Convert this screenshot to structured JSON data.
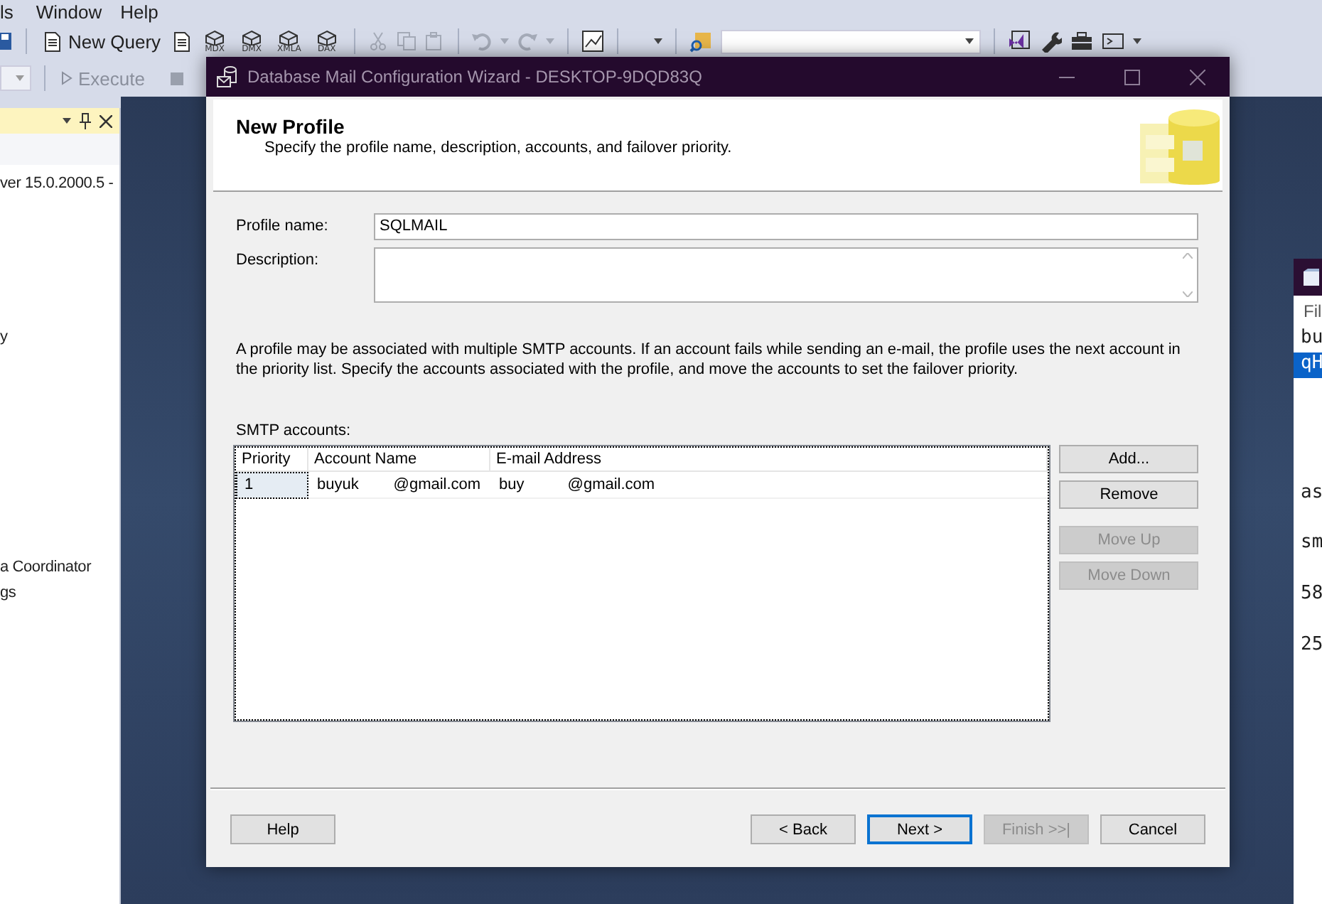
{
  "ide": {
    "menu": [
      {
        "label": "ls"
      },
      {
        "label": "Window"
      },
      {
        "label": "Help"
      }
    ],
    "toolbar": {
      "new_query": "New Query",
      "query_types": [
        "MDX",
        "DMX",
        "XMLA",
        "DAX"
      ],
      "execute": "Execute"
    },
    "object_explorer": {
      "items": [
        "ver 15.0.2000.5 -",
        "y",
        "a Coordinator",
        "gs"
      ]
    }
  },
  "notepad": {
    "menu": "Fil",
    "lines": [
      {
        "text": "bu",
        "selected": false
      },
      {
        "text": "qH",
        "selected": true
      },
      {
        "text": "as",
        "selected": false
      },
      {
        "text": "sm",
        "selected": false
      },
      {
        "text": "58",
        "selected": false
      },
      {
        "text": "25",
        "selected": false
      }
    ]
  },
  "wizard": {
    "title": "Database Mail Configuration Wizard - DESKTOP-9DQD83Q",
    "page_title": "New Profile",
    "page_subtitle": "Specify the profile name, description, accounts, and failover priority.",
    "fields": [
      {
        "kind": "text",
        "label": "Profile name:",
        "value": "SQLMAIL"
      },
      {
        "kind": "multiline",
        "label": "Description:"
      }
    ],
    "info": "A profile may be associated with multiple SMTP accounts. If an account fails while sending an e-mail, the profile uses the next account in the priority list. Specify the accounts associated with the profile, and move the accounts to set the failover priority.",
    "accounts": {
      "label": "SMTP accounts:",
      "columns": [
        "Priority",
        "Account Name",
        "E-mail Address"
      ],
      "rows": [
        {
          "priority": "1",
          "account_name": "buyuk        @gmail.com",
          "email_address": "buy          @gmail.com",
          "selected": true
        }
      ]
    },
    "side_buttons": [
      {
        "label": "Add...",
        "disabled": false
      },
      {
        "label": "Remove",
        "disabled": false
      },
      {
        "label": "Move Up",
        "disabled": true
      },
      {
        "label": "Move Down",
        "disabled": true
      }
    ],
    "buttons": [
      {
        "label": "Help",
        "disabled": false,
        "default": false
      },
      {
        "label": "< Back",
        "disabled": false,
        "default": false
      },
      {
        "label": "Next >",
        "disabled": false,
        "default": true
      },
      {
        "label": "Finish >>|",
        "disabled": true,
        "default": false
      },
      {
        "label": "Cancel",
        "disabled": false,
        "default": false
      }
    ]
  }
}
